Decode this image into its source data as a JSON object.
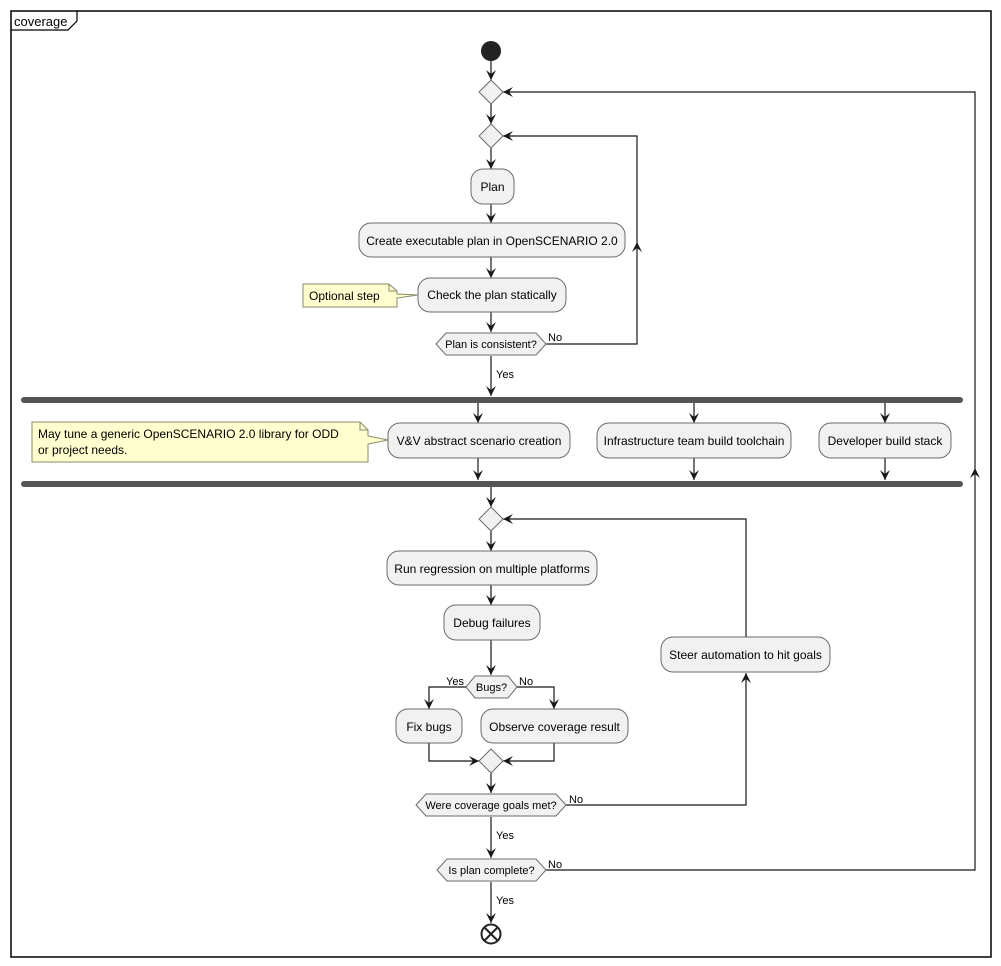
{
  "diagram": {
    "title": "coverage",
    "type": "activity",
    "activities": {
      "plan": "Plan",
      "create_plan": "Create executable plan in OpenSCENARIO 2.0",
      "check_plan": "Check the plan statically",
      "vv_creation": "V&V abstract scenario creation",
      "infra_build": "Infrastructure team build toolchain",
      "dev_build": "Developer build stack",
      "run_regression": "Run regression on multiple platforms",
      "debug_failures": "Debug failures",
      "fix_bugs": "Fix bugs",
      "observe_coverage": "Observe coverage result",
      "steer_automation": "Steer automation to hit goals"
    },
    "decisions": {
      "plan_consistent": "Plan is consistent?",
      "bugs": "Bugs?",
      "coverage_met": "Were coverage goals met?",
      "plan_complete": "Is plan complete?"
    },
    "notes": {
      "optional_step": "Optional step",
      "tune_library_line1": "May tune a generic OpenSCENARIO 2.0 library for ODD",
      "tune_library_line2": "or project needs."
    },
    "labels": {
      "yes": "Yes",
      "no": "No"
    }
  }
}
